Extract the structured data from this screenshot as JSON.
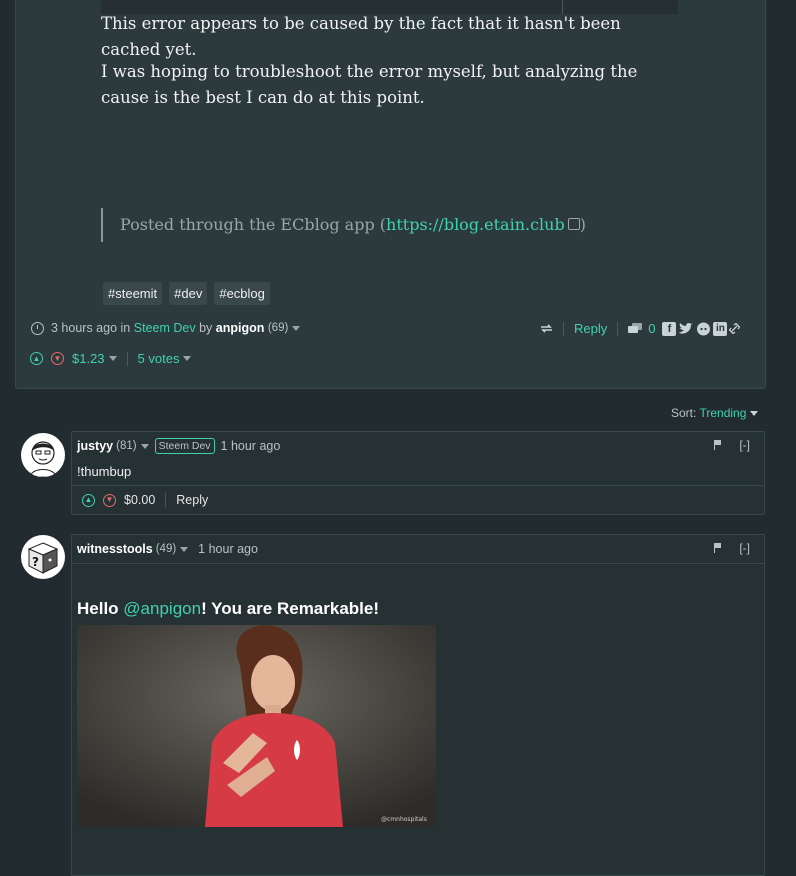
{
  "post": {
    "paragraph1": "This error appears to be caused by the fact that it hasn't been cached yet.",
    "paragraph2": "I was hoping to troubleshoot the error myself, but analyzing the cause is the best I can do at this point.",
    "quote_prefix": "Posted through the ECblog app (",
    "quote_link": "https://blog.etain.club",
    "quote_suffix": ")",
    "tags": [
      "#steemit",
      "#dev",
      "#ecblog"
    ],
    "meta": {
      "time": "3 hours ago",
      "in": "in",
      "community": "Steem Dev",
      "by": "by",
      "author": "anpigon",
      "reputation": "(69)"
    },
    "actions": {
      "reply": "Reply",
      "comments": "0"
    },
    "payout": "$1.23",
    "votes": "5 votes",
    "share_icons": [
      "facebook-icon",
      "twitter-icon",
      "reddit-icon",
      "linkedin-icon",
      "link-icon"
    ]
  },
  "sort": {
    "label": "Sort:",
    "value": "Trending"
  },
  "comments": [
    {
      "author": "justyy",
      "reputation": "(81)",
      "badge": "Steem Dev",
      "time": "1 hour ago",
      "body": "!thumbup",
      "payout": "$0.00",
      "reply": "Reply",
      "collapse": "[-]"
    },
    {
      "author": "witnesstools",
      "reputation": "(49)",
      "time": "1 hour ago",
      "greeting_prefix": "Hello ",
      "greeting_mention": "@anpigon",
      "greeting_suffix": "! You are Remarkable!",
      "collapse": "[-]",
      "image_watermark": "@cmnhospitals"
    }
  ],
  "colors": {
    "accent": "#3fd1b0",
    "downvote": "#e56b6b",
    "background": "#212b30",
    "card": "#2c3a3e"
  }
}
